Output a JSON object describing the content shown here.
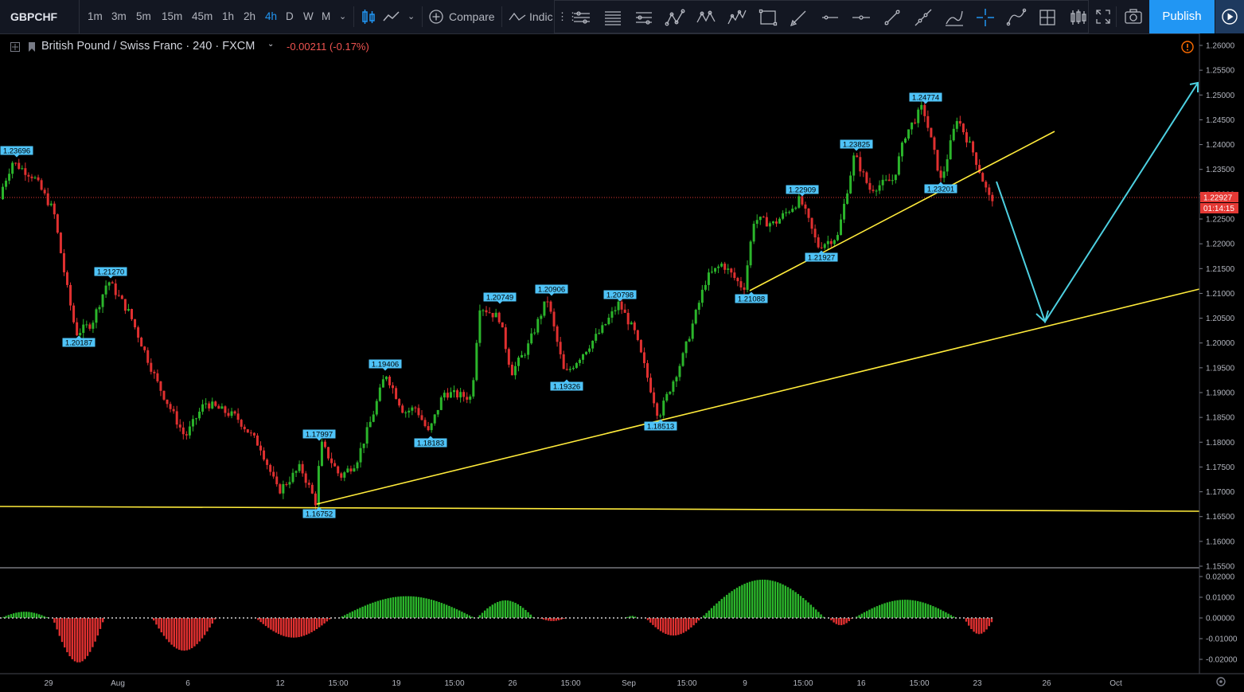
{
  "toolbar": {
    "symbol": "GBPCHF",
    "timeframes": [
      "1m",
      "3m",
      "5m",
      "15m",
      "45m",
      "1h",
      "2h",
      "4h",
      "D",
      "W",
      "M"
    ],
    "active_timeframe": "4h",
    "compare_label": "Compare",
    "indicators_label": "Indic",
    "publish_label": "Publish"
  },
  "legend": {
    "title": "British Pound / Swiss Franc · 240 · FXCM",
    "change": "-0.00211 (-0.17%)"
  },
  "price_axis": {
    "labels": [
      "1.26000",
      "1.25500",
      "1.25000",
      "1.24500",
      "1.24000",
      "1.23500",
      "1.23000",
      "1.22500",
      "1.22000",
      "1.21500",
      "1.21000",
      "1.20500",
      "1.20000",
      "1.19500",
      "1.19000",
      "1.18500",
      "1.18000",
      "1.17500",
      "1.17000",
      "1.16500",
      "1.16000",
      "1.15500"
    ],
    "current_price": "1.22927",
    "countdown": "01:14:15"
  },
  "indicator_axis": {
    "labels": [
      "0.02000",
      "0.01000",
      "0.00000",
      "-0.01000",
      "-0.02000"
    ]
  },
  "time_axis": {
    "labels": [
      "29",
      "Aug",
      "6",
      "12",
      "15:00",
      "19",
      "15:00",
      "26",
      "15:00",
      "Sep",
      "15:00",
      "9",
      "15:00",
      "16",
      "15:00",
      "23",
      "26",
      "Oct"
    ]
  },
  "pivot_labels": [
    "1.23696",
    "1.21270",
    "1.20187",
    "1.17997",
    "1.16752",
    "1.19406",
    "1.18183",
    "1.20749",
    "1.20906",
    "1.19326",
    "1.20798",
    "1.18513",
    "1.21088",
    "1.22909",
    "1.21927",
    "1.23825",
    "1.24774",
    "1.23201"
  ],
  "colors": {
    "up": "#26a69a",
    "candle_up": "#2bb52b",
    "candle_down": "#e03030",
    "trendline": "#ffeb3b",
    "arrow": "#4dd0e1",
    "tag": "#4fc3f7",
    "price_tag": "#e53935",
    "accent": "#2196f3"
  }
}
